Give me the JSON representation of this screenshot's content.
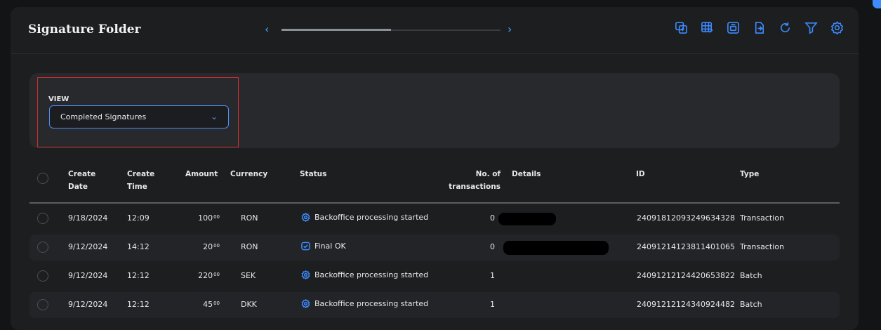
{
  "header": {
    "title": "Signature Folder",
    "prev": "‹",
    "next": "›",
    "scroll_progress": 0.5
  },
  "toolbar": [
    {
      "name": "copy-icon"
    },
    {
      "name": "table-edit-icon"
    },
    {
      "name": "print-icon"
    },
    {
      "name": "export-icon"
    },
    {
      "name": "refresh-icon"
    },
    {
      "name": "filter-icon"
    },
    {
      "name": "settings-icon"
    }
  ],
  "view": {
    "label": "VIEW",
    "selected": "Completed Signatures"
  },
  "table": {
    "headers": {
      "create_date": "Create\nDate",
      "create_time": "Create\nTime",
      "amount": "Amount",
      "currency": "Currency",
      "status": "Status",
      "transactions": "No. of\ntransactions",
      "details": "Details",
      "id": "ID",
      "type": "Type"
    },
    "rows": [
      {
        "date": "9/18/2024",
        "time": "12:09",
        "amount": "100",
        "cents": "00",
        "currency": "RON",
        "status": "Backoffice processing started",
        "status_icon": "gear-icon",
        "count": "0",
        "id": "24091812093249634328",
        "type": "Transaction"
      },
      {
        "date": "9/12/2024",
        "time": "14:12",
        "amount": "20",
        "cents": "00",
        "currency": "RON",
        "status": "Final OK",
        "status_icon": "check-badge-icon",
        "count": "0",
        "id": "24091214123811401065",
        "type": "Transaction"
      },
      {
        "date": "9/12/2024",
        "time": "12:12",
        "amount": "220",
        "cents": "00",
        "currency": "SEK",
        "status": "Backoffice processing started",
        "status_icon": "gear-icon",
        "count": "1",
        "id": "24091212124420653822",
        "type": "Batch"
      },
      {
        "date": "9/12/2024",
        "time": "12:12",
        "amount": "45",
        "cents": "00",
        "currency": "DKK",
        "status": "Backoffice processing started",
        "status_icon": "gear-icon",
        "count": "1",
        "id": "24091212124340924482",
        "type": "Batch"
      }
    ]
  },
  "colors": {
    "accent": "#3d8bff",
    "highlight": "#d12f2f"
  }
}
